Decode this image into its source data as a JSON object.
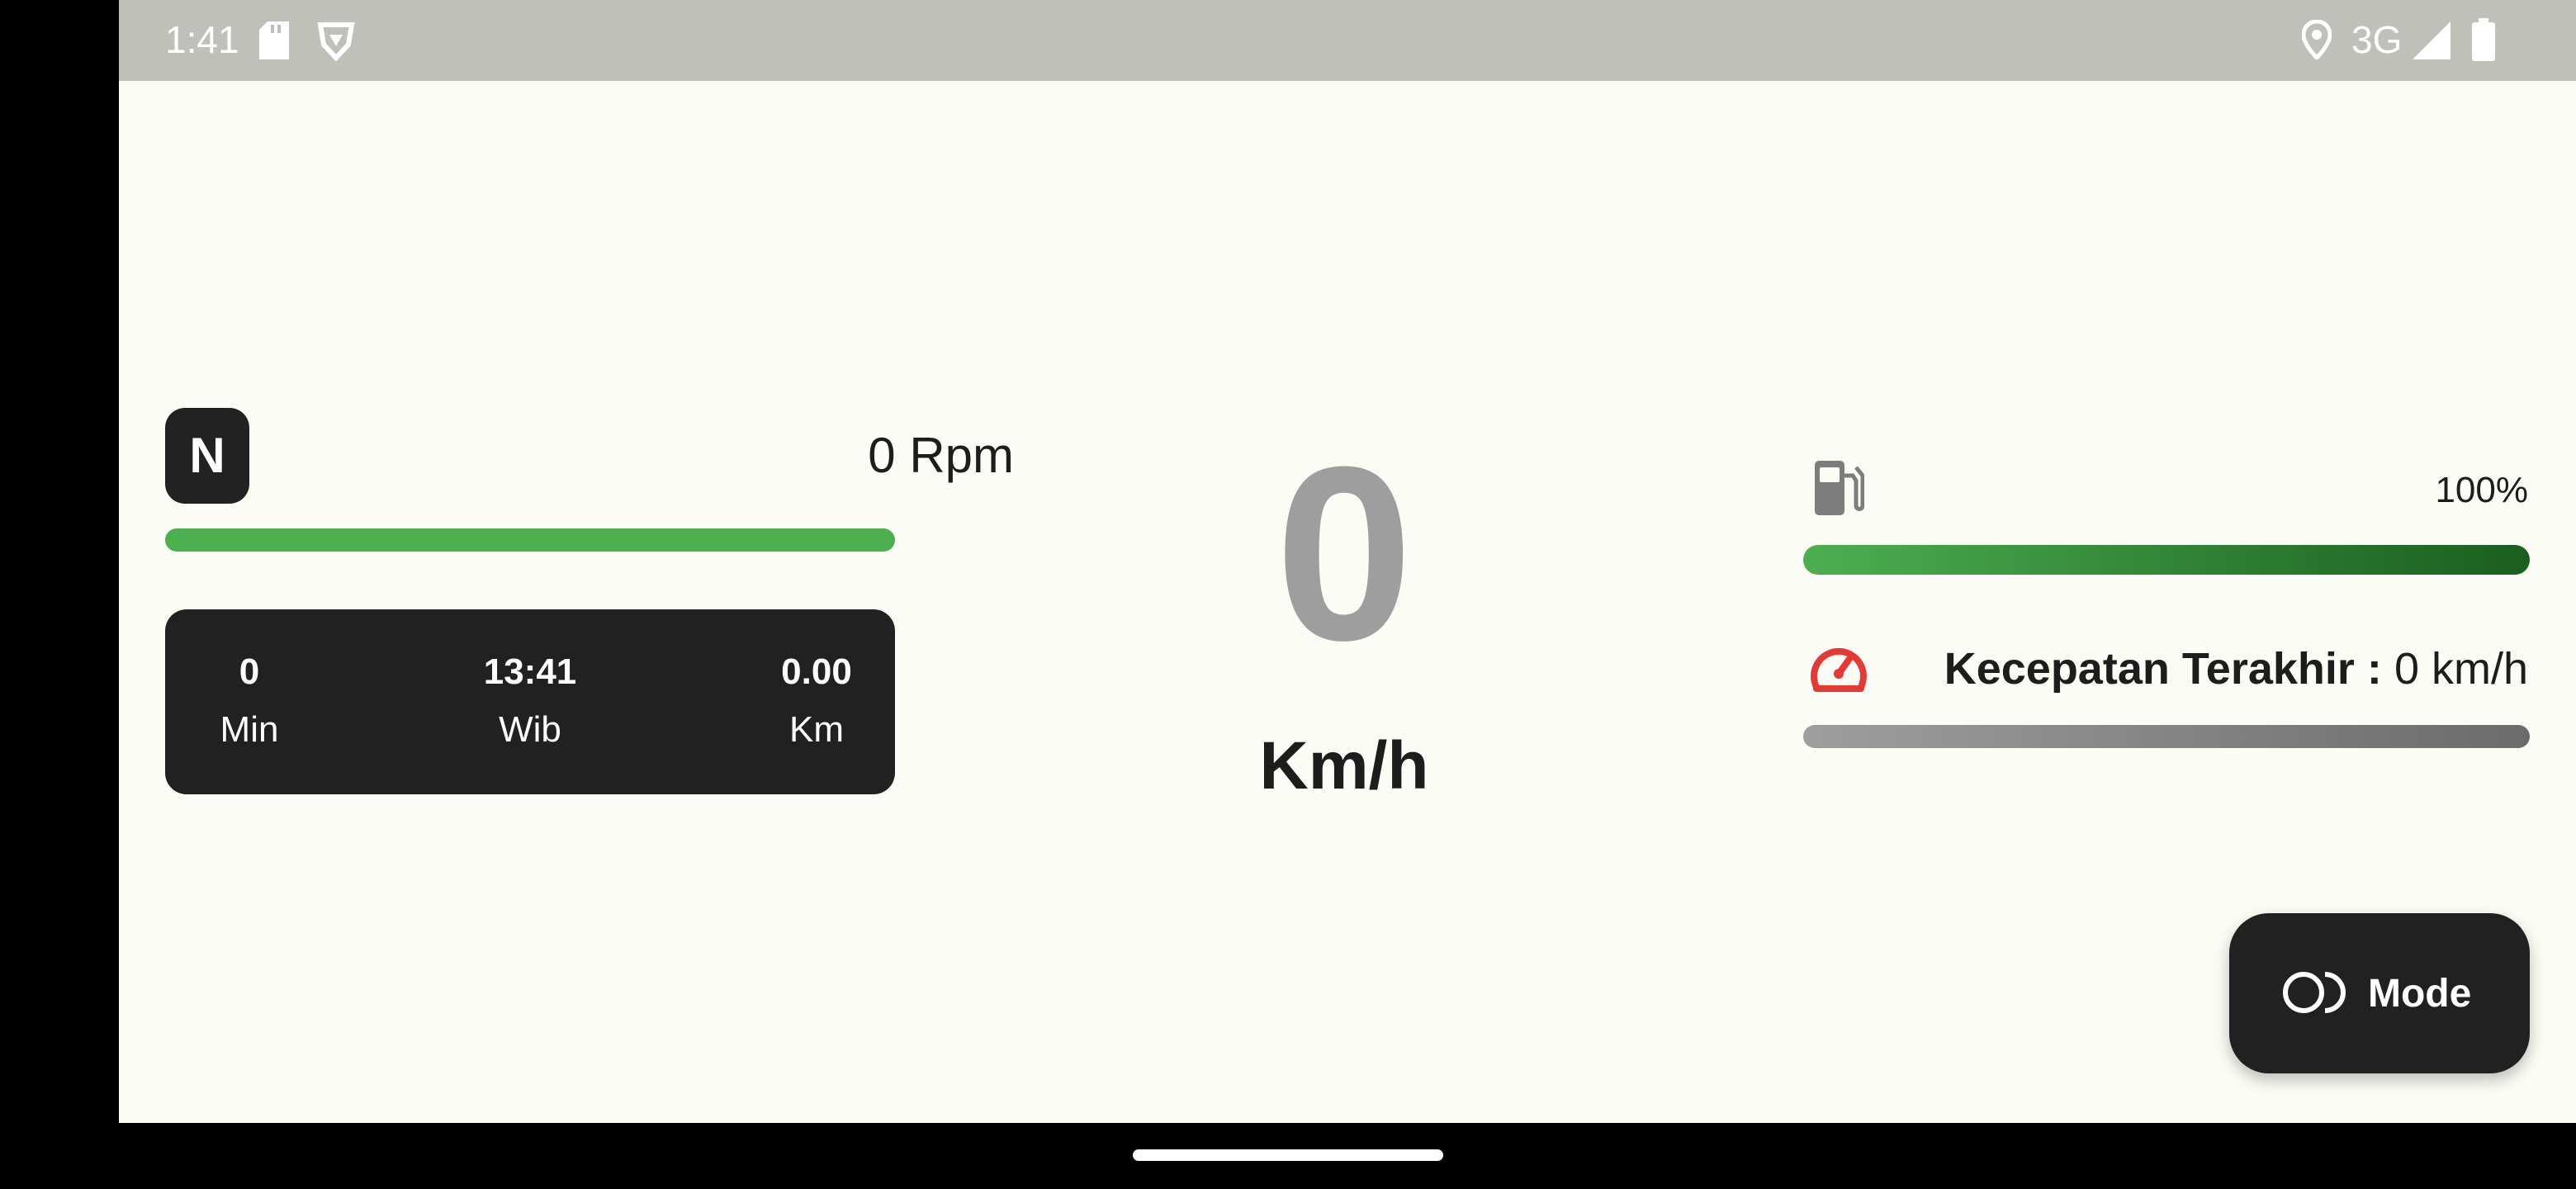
{
  "status_bar": {
    "time": "1:41",
    "network": "3G",
    "icons": [
      "sd-card-icon",
      "vpn-shield-icon",
      "location-icon",
      "signal-icon",
      "battery-icon"
    ]
  },
  "dashboard": {
    "gear": "N",
    "rpm_text": "0 Rpm",
    "rpm_level": 1.0,
    "trip": {
      "duration_value": "0",
      "duration_label": "Min",
      "clock_value": "13:41",
      "clock_label": "Wib",
      "distance_value": "0.00",
      "distance_label": "Km"
    },
    "speed_value": "0",
    "speed_unit": "Km/h",
    "fuel_icon": "fuel-pump-icon",
    "fuel_percent": "100%",
    "fuel_level": 1.0,
    "last_speed_icon": "speedometer-icon",
    "last_speed_label": "Kecepatan Terakhir :",
    "last_speed_value": "0 km/h",
    "last_speed_level": 1.0
  },
  "mode_button": {
    "icon": "mode-toggle-icon",
    "label": "Mode"
  },
  "colors": {
    "background": "#FBFCF5",
    "accent_green": "#4CAF50",
    "dark_card": "#212121",
    "speed_gray": "#9E9E9E",
    "alert_red": "#E53935",
    "status_bar": "#BFC0BA"
  }
}
